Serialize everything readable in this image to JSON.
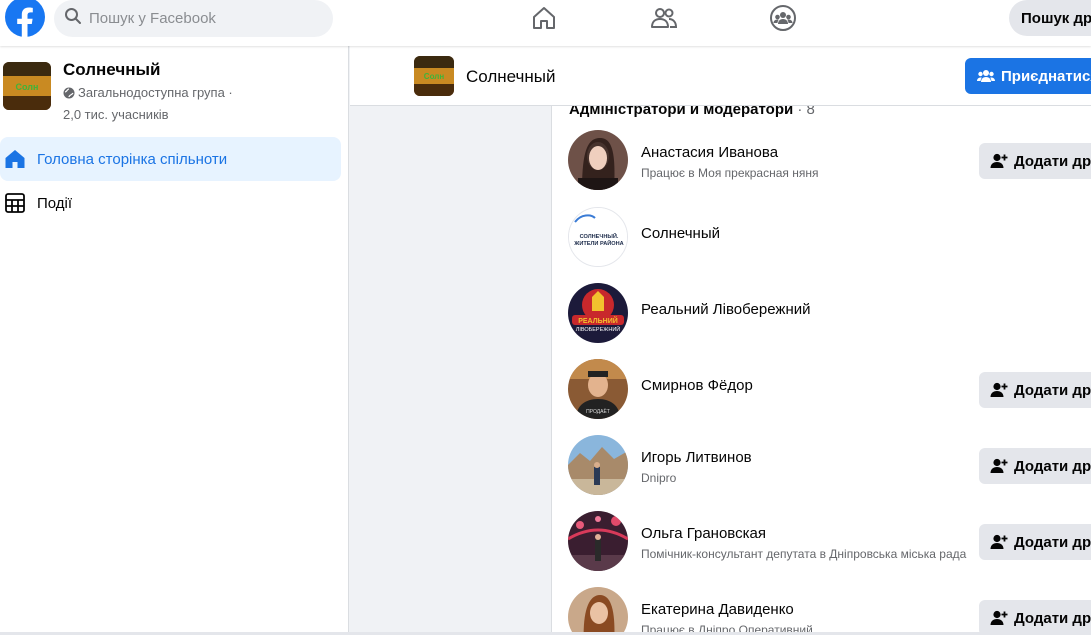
{
  "search": {
    "placeholder": "Пошук у Facebook"
  },
  "topbar": {
    "nav_icons": [
      "home-icon",
      "friends-icon",
      "groups-icon"
    ],
    "search_button_label": "Пошук др"
  },
  "sidebar": {
    "group_name": "Солнечный",
    "privacy": "Загальнодоступна група ·",
    "members": "2,0 тис. учасників",
    "items": [
      {
        "label": "Головна сторінка спільноти",
        "icon": "home-icon",
        "active": true
      },
      {
        "label": "Події",
        "icon": "calendar-icon",
        "active": false
      }
    ]
  },
  "group_header": {
    "name": "Солнечный",
    "join_label": "Приєднатися"
  },
  "admins": {
    "title": "Адміністратори и модератори",
    "count": "· 8",
    "add_friend_label": "Додати дру",
    "members": [
      {
        "name": "Анастасия Иванова",
        "sub": "Працює в Моя прекрасная няня",
        "has_add": true
      },
      {
        "name": "Солнечный",
        "sub": "",
        "has_add": false,
        "avatar_text": "СОЛНЕЧНЫЙ. ЖИТЕЛИ РАЙОНА"
      },
      {
        "name": "Реальний Лівобережний",
        "sub": "",
        "has_add": false,
        "avatar_text": "РЕАЛЬНИЙ ЛІВОБЕРЕЖНИЙ"
      },
      {
        "name": "Смирнов Фёдор",
        "sub": "",
        "has_add": true
      },
      {
        "name": "Игорь Литвинов",
        "sub": "Dnipro",
        "has_add": true
      },
      {
        "name": "Ольга Грановская",
        "sub": "Помічник-консультант депутата в Дніпровська міська рада",
        "has_add": true
      },
      {
        "name": "Екатерина Давиденко",
        "sub": "Працює в Дніпро Оперативний",
        "has_add": true
      }
    ]
  },
  "colors": {
    "brand": "#1877f2",
    "button_primary": "#1b74e4",
    "active_bg": "#e7f3ff",
    "secondary_button": "#e4e6eb"
  }
}
